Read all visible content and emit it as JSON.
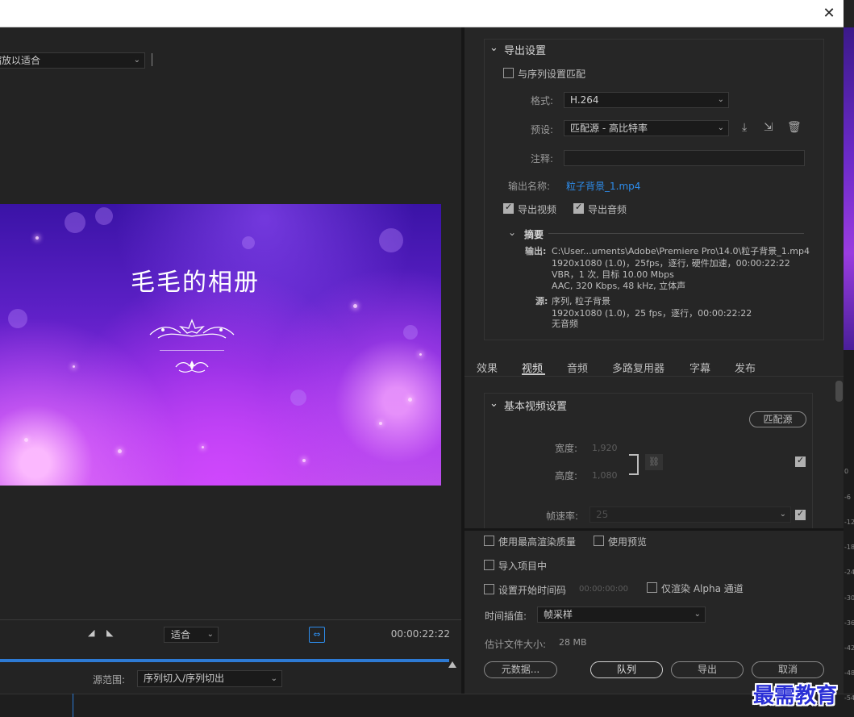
{
  "window": {
    "close_glyph": "✕"
  },
  "source": {
    "zoom_value": "缩放以适合",
    "preview_title": "毛毛的相册",
    "fit_value": "适合",
    "timecode": "00:00:22:22",
    "source_range_label": "源范围:",
    "source_range_value": "序列切入/序列切出",
    "progress": 1.0
  },
  "export_settings": {
    "header": "导出设置",
    "match_sequence_label": "与序列设置匹配",
    "match_sequence_checked": false,
    "format_label": "格式:",
    "format_value": "H.264",
    "preset_label": "预设:",
    "preset_value": "匹配源 - 高比特率",
    "comments_label": "注释:",
    "comments_value": "",
    "output_name_label": "输出名称:",
    "output_name_value": "粒子背景_1.mp4",
    "export_video_label": "导出视频",
    "export_video_checked": true,
    "export_audio_label": "导出音频",
    "export_audio_checked": true,
    "summary": {
      "header": "摘要",
      "output_label": "输出:",
      "output_lines": [
        "C:\\User...uments\\Adobe\\Premiere Pro\\14.0\\粒子背景_1.mp4",
        "1920x1080 (1.0)，25fps，逐行, 硬件加速，00:00:22:22",
        "VBR，1 次, 目标 10.00 Mbps",
        "AAC, 320 Kbps, 48 kHz, 立体声"
      ],
      "source_label": "源:",
      "source_lines": [
        "序列, 粒子背景",
        "1920x1080 (1.0)，25 fps，逐行，00:00:22:22",
        "无音频"
      ]
    }
  },
  "tabs": [
    {
      "label": "效果"
    },
    {
      "label": "视频"
    },
    {
      "label": "音频"
    },
    {
      "label": "多路复用器"
    },
    {
      "label": "字幕"
    },
    {
      "label": "发布"
    }
  ],
  "video_settings": {
    "header": "基本视频设置",
    "match_source_label": "匹配源",
    "width_label": "宽度:",
    "width_value": "1,920",
    "height_label": "高度:",
    "height_value": "1,080",
    "frame_rate_label": "帧速率:",
    "frame_rate_value": "25"
  },
  "bottom_options": {
    "max_render_label": "使用最高渲染质量",
    "use_previews_label": "使用预览",
    "import_project_label": "导入项目中",
    "set_start_tc_label": "设置开始时间码",
    "start_tc_value": "00:00:00:00",
    "render_alpha_label": "仅渲染 Alpha 通道",
    "time_interp_label": "时间插值:",
    "time_interp_value": "帧采样",
    "est_size_label": "估计文件大小:",
    "est_size_value": "28 MB"
  },
  "buttons": {
    "metadata": "元数据...",
    "queue": "队列",
    "export": "导出",
    "cancel": "取消"
  },
  "meter_ticks": [
    "0",
    "-6",
    "-12",
    "-18",
    "-24",
    "-30",
    "-36",
    "-42",
    "-48",
    "-54"
  ],
  "watermark": "最需教育",
  "colors": {
    "accent_blue": "#2d7ad4",
    "link_blue": "#2d8ceb"
  }
}
